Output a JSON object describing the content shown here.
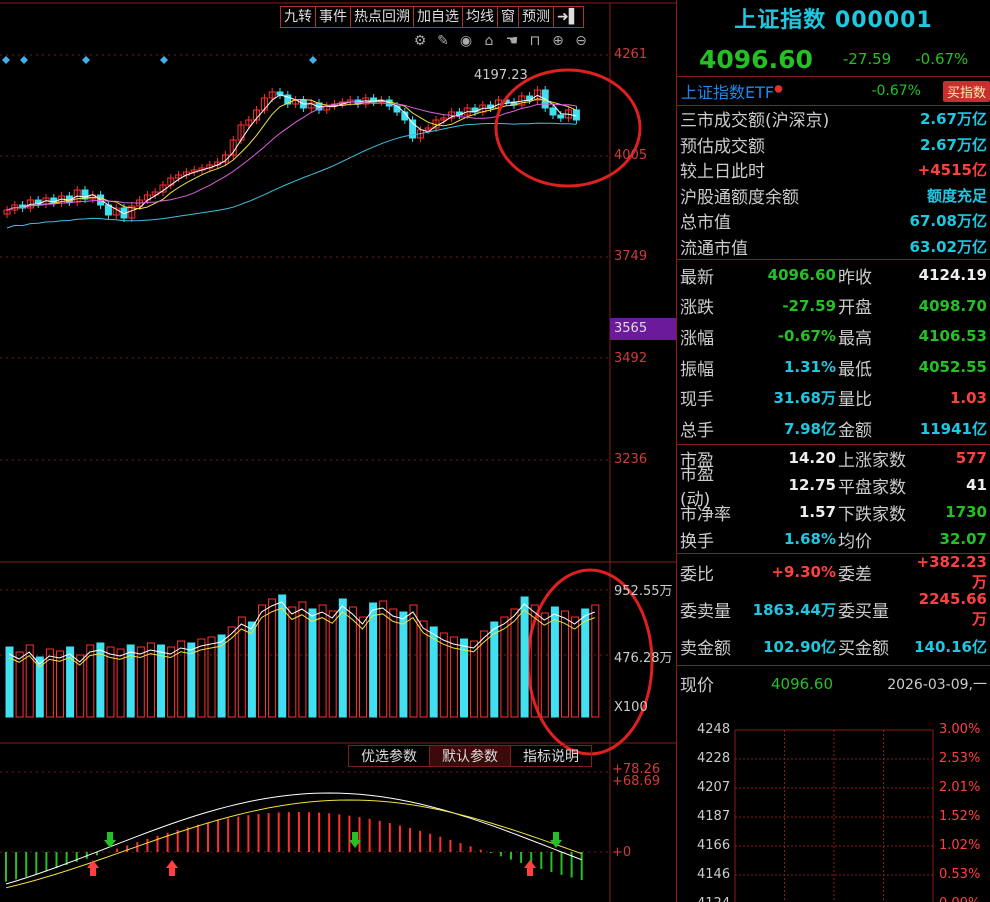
{
  "toolbar": [
    "九转",
    "事件",
    "热点回溯",
    "加自选",
    "均线",
    "窗",
    "预测",
    "➜▌"
  ],
  "chart_tools": [
    "⚙",
    "✎",
    "◉",
    "⌂",
    "☚",
    "⊓",
    "⊕",
    "⊖"
  ],
  "price_axis": [
    "4261",
    "4005",
    "3749",
    "3492",
    "3236"
  ],
  "price_axis_current": "3565",
  "high_label": "4197.23",
  "volume_axis": [
    "952.55万",
    "476.28万",
    "X100"
  ],
  "indicator_axis": [
    "+78.26",
    "+68.69",
    "+0"
  ],
  "indicator_tabs": [
    "优选参数",
    "默认参数",
    "指标说明"
  ],
  "colors": {
    "up": "#ff3030",
    "down": "#40e0f0",
    "panel_border": "#8a1c1c",
    "purple_marker": "#6a1a9a"
  },
  "panel": {
    "title": "上证指数 000001",
    "price": "4096.60",
    "change": "-27.59",
    "change_pct": "-0.67%",
    "etf": {
      "name": "上证指数ETF",
      "change_pct": "-0.67%",
      "buy_label": "买指数"
    },
    "summary": [
      {
        "label": "三市成交额(沪深京)",
        "value": "2.67万亿",
        "color": "cyan"
      },
      {
        "label": "预估成交额",
        "value": "2.67万亿",
        "color": "cyan"
      },
      {
        "label": "较上日此时",
        "value": "+4515亿",
        "color": "red"
      },
      {
        "label": "沪股通额度余额",
        "value": "额度充足",
        "color": "cyan"
      },
      {
        "label": "总市值",
        "value": "67.08万亿",
        "color": "cyan"
      },
      {
        "label": "流通市值",
        "value": "63.02万亿",
        "color": "cyan"
      }
    ],
    "quote": [
      {
        "l1": "最新",
        "v1": "4096.60",
        "c1": "green",
        "l2": "昨收",
        "v2": "4124.19",
        "c2": "white"
      },
      {
        "l1": "涨跌",
        "v1": "-27.59",
        "c1": "green",
        "l2": "开盘",
        "v2": "4098.70",
        "c2": "green"
      },
      {
        "l1": "涨幅",
        "v1": "-0.67%",
        "c1": "green",
        "l2": "最高",
        "v2": "4106.53",
        "c2": "green"
      },
      {
        "l1": "振幅",
        "v1": "1.31%",
        "c1": "cyan",
        "l2": "最低",
        "v2": "4052.55",
        "c2": "green"
      },
      {
        "l1": "现手",
        "v1": "31.68万",
        "c1": "cyan",
        "l2": "量比",
        "v2": "1.03",
        "c2": "red"
      },
      {
        "l1": "总手",
        "v1": "7.98亿",
        "c1": "cyan",
        "l2": "金额",
        "v2": "11941亿",
        "c2": "cyan"
      }
    ],
    "valuation": [
      {
        "l1": "市盈",
        "v1": "14.20",
        "c1": "white",
        "l2": "上涨家数",
        "v2": "577",
        "c2": "red"
      },
      {
        "l1": "市盈(动)",
        "v1": "12.75",
        "c1": "white",
        "l2": "平盘家数",
        "v2": "41",
        "c2": "white"
      },
      {
        "l1": "市净率",
        "v1": "1.57",
        "c1": "white",
        "l2": "下跌家数",
        "v2": "1730",
        "c2": "green"
      },
      {
        "l1": "换手",
        "v1": "1.68%",
        "c1": "cyan",
        "l2": "均价",
        "v2": "32.07",
        "c2": "green"
      }
    ],
    "orders": [
      {
        "l1": "委比",
        "v1": "+9.30%",
        "c1": "red",
        "l2": "委差",
        "v2": "+382.23万",
        "c2": "red"
      },
      {
        "l1": "委卖量",
        "v1": "1863.44万",
        "c1": "cyan",
        "l2": "委买量",
        "v2": "2245.66万",
        "c2": "red"
      },
      {
        "l1": "卖金额",
        "v1": "102.90亿",
        "c1": "cyan",
        "l2": "买金额",
        "v2": "140.16亿",
        "c2": "cyan"
      }
    ],
    "mini": {
      "label": "现价",
      "value": "4096.60",
      "time": "2026-03-09,一",
      "left_axis": [
        "4248",
        "4228",
        "4207",
        "4187",
        "4166",
        "4146",
        "4124"
      ],
      "right_axis": [
        "3.00%",
        "2.53%",
        "2.01%",
        "1.52%",
        "1.02%",
        "0.53%",
        "0.00%"
      ]
    }
  }
}
